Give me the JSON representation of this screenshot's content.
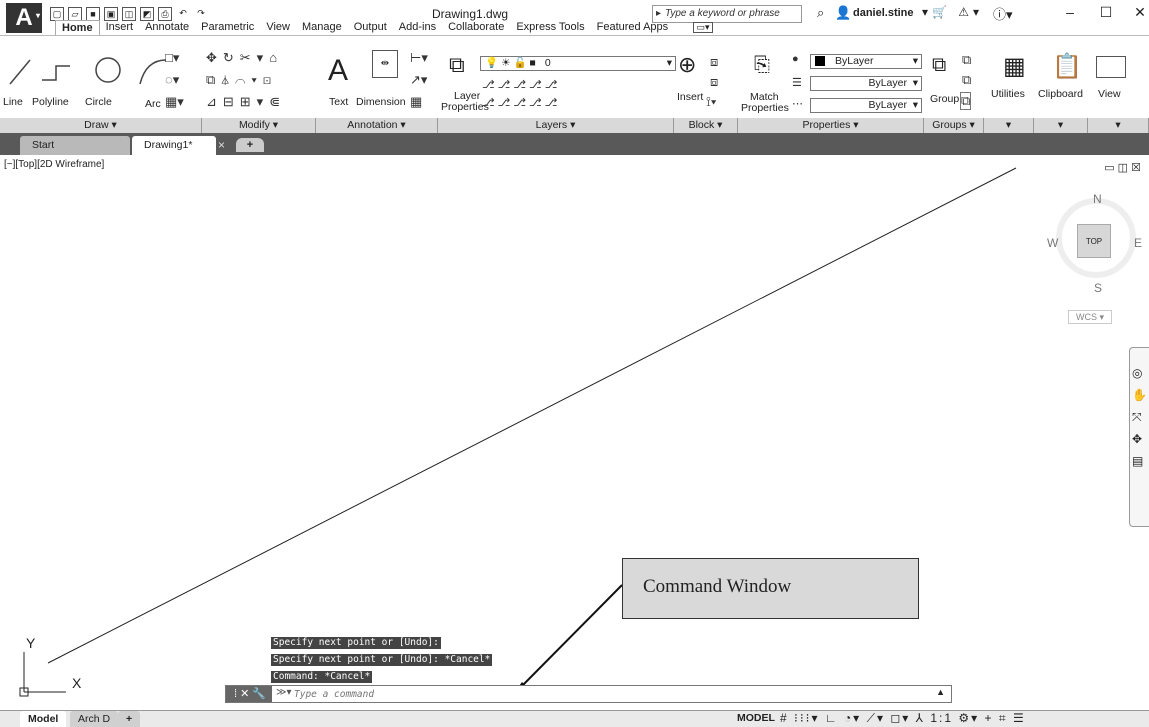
{
  "titlebar": {
    "app_letter": "A",
    "doc_title": "Drawing1.dwg",
    "search_placeholder": "Type a keyword or phrase",
    "username": "daniel.stine",
    "minimize": "–",
    "maximize": "☐",
    "close": "✕"
  },
  "ribbon_tabs": [
    "Home",
    "Insert",
    "Annotate",
    "Parametric",
    "View",
    "Manage",
    "Output",
    "Add-ins",
    "Collaborate",
    "Express Tools",
    "Featured Apps"
  ],
  "draw": {
    "line": "Line",
    "polyline": "Polyline",
    "circle": "Circle",
    "arc": "Arc",
    "panel": "Draw ▾"
  },
  "modify": {
    "panel": "Modify ▾"
  },
  "annotation": {
    "text": "Text",
    "dimension": "Dimension",
    "panel": "Annotation ▾"
  },
  "layers": {
    "layer": "Layer",
    "properties": "Properties",
    "current": "0",
    "panel": "Layers ▾"
  },
  "block": {
    "insert": "Insert",
    "panel": "Block ▾"
  },
  "properties": {
    "match": "Match",
    "match2": "Properties",
    "color": "ByLayer",
    "linetype": "ByLayer",
    "lineweight": "ByLayer",
    "panel": "Properties ▾"
  },
  "groups": {
    "group": "Group",
    "panel": "Groups ▾"
  },
  "utilities": {
    "label": "Utilities",
    "panel": "▾"
  },
  "clipboard": {
    "label": "Clipboard",
    "panel": "▾"
  },
  "view": {
    "label": "View",
    "panel": "▾"
  },
  "file_tabs": {
    "start": "Start",
    "drawing": "Drawing1*",
    "close": "×",
    "plus": "+"
  },
  "viewport": {
    "label": "[−][Top][2D Wireframe]",
    "controls": "▭ ◫ ☒",
    "compass": {
      "n": "N",
      "s": "S",
      "e": "E",
      "w": "W",
      "top": "TOP"
    },
    "wcs": "WCS ▾"
  },
  "command_history": [
    "Specify next point or [Undo]:",
    "Specify next point or [Undo]: *Cancel*",
    "Command: *Cancel*"
  ],
  "command_line": {
    "placeholder": "Type a command",
    "prompt": "≫▾",
    "handle": "⁞ ✕ 🔧"
  },
  "callout": "Command Window",
  "ucs": {
    "y": "Y",
    "x": "X"
  },
  "layout_tabs": {
    "model": "Model",
    "arch": "Arch D",
    "plus": "+"
  },
  "statusbar": {
    "model": "MODEL",
    "scale": "1:1"
  }
}
